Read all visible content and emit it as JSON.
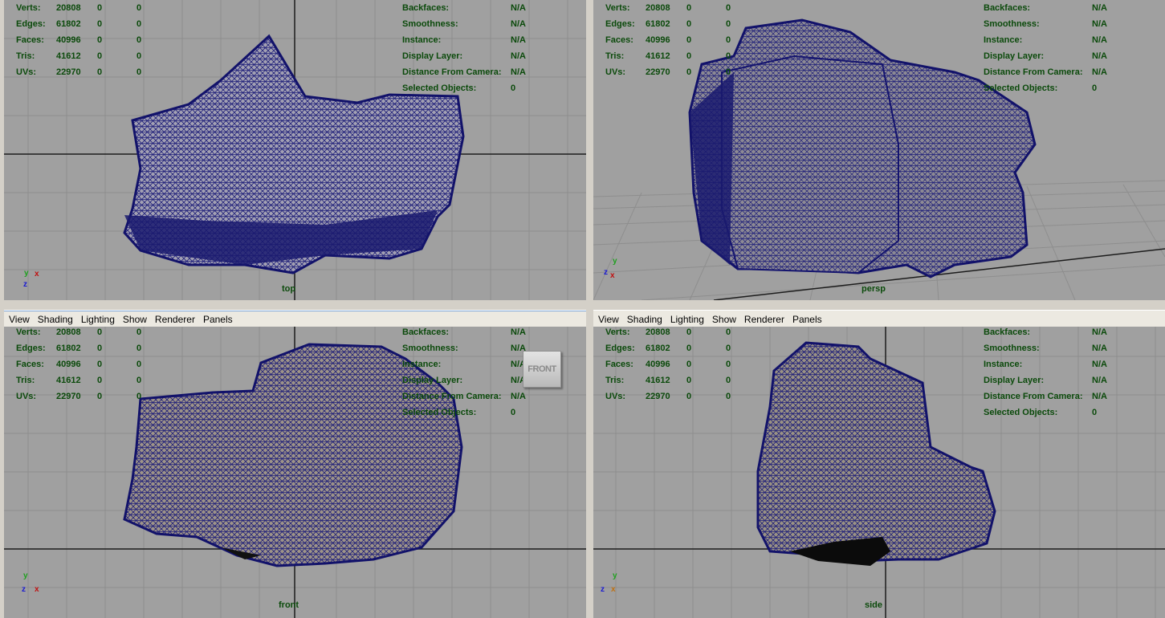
{
  "menu": [
    "View",
    "Shading",
    "Lighting",
    "Show",
    "Renderer",
    "Panels"
  ],
  "hud_left": [
    {
      "label": "Verts:",
      "v1": "20808",
      "v2": "0",
      "v3": "0"
    },
    {
      "label": "Edges:",
      "v1": "61802",
      "v2": "0",
      "v3": "0"
    },
    {
      "label": "Faces:",
      "v1": "40996",
      "v2": "0",
      "v3": "0"
    },
    {
      "label": "Tris:",
      "v1": "41612",
      "v2": "0",
      "v3": "0"
    },
    {
      "label": "UVs:",
      "v1": "22970",
      "v2": "0",
      "v3": "0"
    }
  ],
  "hud_right": [
    {
      "label": "Backfaces:",
      "value": "N/A"
    },
    {
      "label": "Smoothness:",
      "value": "N/A"
    },
    {
      "label": "Instance:",
      "value": "N/A"
    },
    {
      "label": "Display Layer:",
      "value": "N/A"
    },
    {
      "label": "Distance From Camera:",
      "value": "N/A"
    },
    {
      "label": "Selected Objects:",
      "value": "0"
    }
  ],
  "viewports": {
    "top": {
      "camera": "top",
      "axis_a": "y",
      "axis_b": "x",
      "axis_c": "z"
    },
    "persp": {
      "camera": "persp",
      "axis_a": "y",
      "axis_b": "z",
      "axis_c": "x"
    },
    "front": {
      "camera": "front",
      "axis_a": "y",
      "axis_b": "z",
      "axis_c": "x"
    },
    "side": {
      "camera": "side",
      "axis_a": "y",
      "axis_b": "z",
      "axis_c": "x"
    }
  },
  "view_cube_label": "FRONT",
  "colors": {
    "viewport_bg": "#a0a0a0",
    "grid_line": "#8c8c8c",
    "axis_line": "#1a1a1a",
    "hud_text": "#0b4a0b",
    "wire": "#1a1a7a",
    "surface": "#8a8090"
  }
}
